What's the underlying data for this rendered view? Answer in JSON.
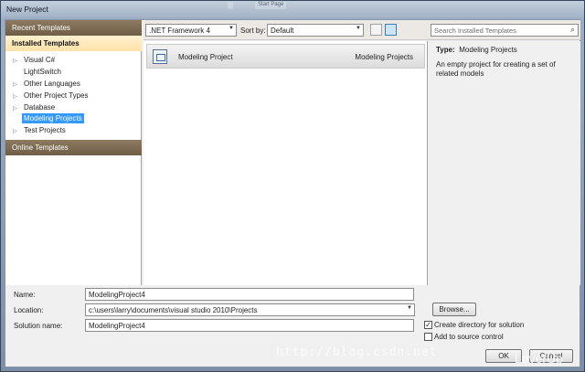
{
  "window": {
    "title": "New Project",
    "ghost_tabs": [
      "",
      "Start Page"
    ]
  },
  "sidebar": {
    "recent_header": "Recent Templates",
    "installed_header": "Installed Templates",
    "items": [
      {
        "label": "Visual C#",
        "expandable": true,
        "selected": false
      },
      {
        "label": "LightSwitch",
        "expandable": false,
        "selected": false
      },
      {
        "label": "Other Languages",
        "expandable": true,
        "selected": false
      },
      {
        "label": "Other Project Types",
        "expandable": true,
        "selected": false
      },
      {
        "label": "Database",
        "expandable": true,
        "selected": false
      },
      {
        "label": "Modeling Projects",
        "expandable": false,
        "selected": true
      },
      {
        "label": "Test Projects",
        "expandable": true,
        "selected": false
      }
    ],
    "online_header": "Online Templates"
  },
  "toolbar": {
    "framework_value": ".NET Framework 4",
    "sort_label": "Sort by:",
    "sort_value": "Default",
    "search_placeholder": "Search Installed Templates"
  },
  "templates": [
    {
      "name": "Modeling Project",
      "category": "Modeling Projects",
      "icon": "modeling-project-icon"
    }
  ],
  "info": {
    "type_label": "Type:",
    "type_value": "Modeling Projects",
    "description": "An empty project for creating a set of related models"
  },
  "form": {
    "name_label": "Name:",
    "name_value": "ModelingProject4",
    "location_label": "Location:",
    "location_value": "c:\\users\\larry\\documents\\visual studio 2010\\Projects",
    "solution_label": "Solution name:",
    "solution_value": "ModelingProject4",
    "browse_label": "Browse...",
    "create_dir_label": "Create directory for solution",
    "create_dir_checked": true,
    "source_control_label": "Add to source control",
    "source_control_checked": false,
    "ok_label": "OK",
    "cancel_label": "Cancel"
  },
  "watermarks": {
    "url": "http://blog.csdn.net",
    "brand": "LeverUp"
  },
  "colors": {
    "selection": "#3399ff",
    "header_brown": "#7c6a52",
    "installed_highlight": "#fde2a8"
  }
}
